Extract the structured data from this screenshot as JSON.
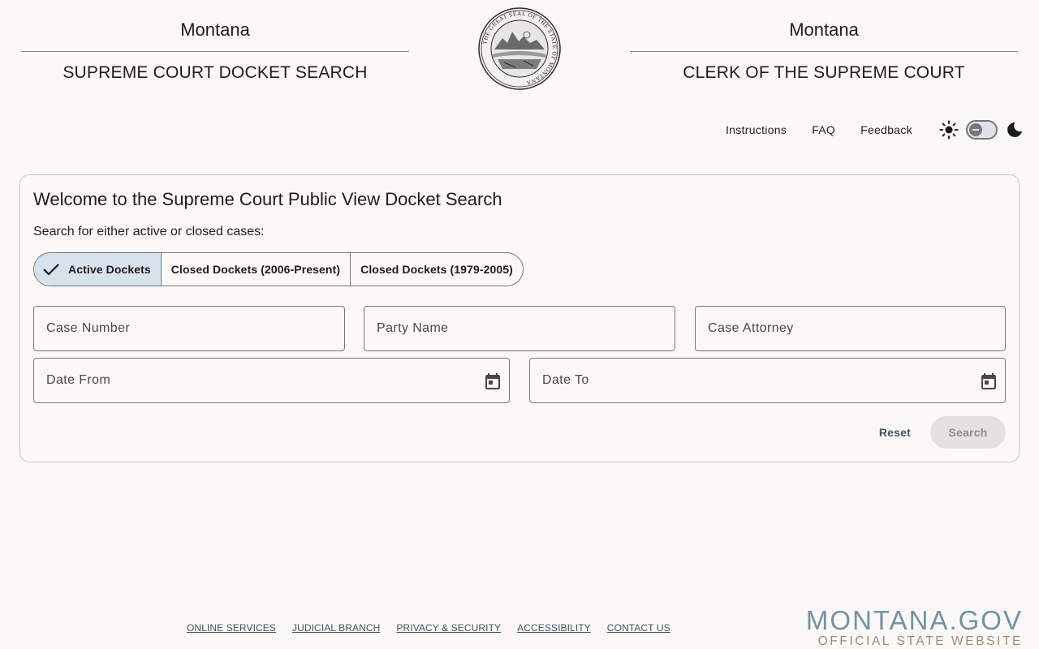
{
  "header": {
    "left_state": "Montana",
    "left_subtitle": "SUPREME COURT DOCKET SEARCH",
    "right_state": "Montana",
    "right_subtitle": "CLERK OF THE SUPREME COURT",
    "seal_text": "THE GREAT SEAL OF THE STATE OF MONTANA"
  },
  "nav": {
    "links": [
      "Instructions",
      "FAQ",
      "Feedback"
    ],
    "theme_toggle": "off"
  },
  "card": {
    "title": "Welcome to the Supreme Court Public View Docket Search",
    "subtitle": "Search for either active or closed cases:",
    "segments": [
      {
        "label": "Active Dockets",
        "selected": true
      },
      {
        "label": "Closed Dockets (2006-Present)",
        "selected": false
      },
      {
        "label": "Closed Dockets (1979-2005)",
        "selected": false
      }
    ],
    "fields": {
      "case_number": {
        "placeholder": "Case Number",
        "value": ""
      },
      "party_name": {
        "placeholder": "Party Name",
        "value": ""
      },
      "case_attorney": {
        "placeholder": "Case Attorney",
        "value": ""
      },
      "date_from": {
        "placeholder": "Date From",
        "value": ""
      },
      "date_to": {
        "placeholder": "Date To",
        "value": ""
      }
    },
    "reset_label": "Reset",
    "search_label": "Search"
  },
  "footer": {
    "links": [
      "ONLINE SERVICES",
      "JUDICIAL BRANCH",
      "PRIVACY & SECURITY",
      "ACCESSIBILITY",
      "CONTACT US"
    ],
    "brand_big": "MONTANA.GOV",
    "brand_small": "OFFICIAL STATE WEBSITE"
  },
  "colors": {
    "background": "#fbf8f7",
    "segment_active": "#d7e3ec",
    "link": "#3e5562",
    "brand_blue": "#6f95a1",
    "brand_gold": "#a08c6f"
  }
}
